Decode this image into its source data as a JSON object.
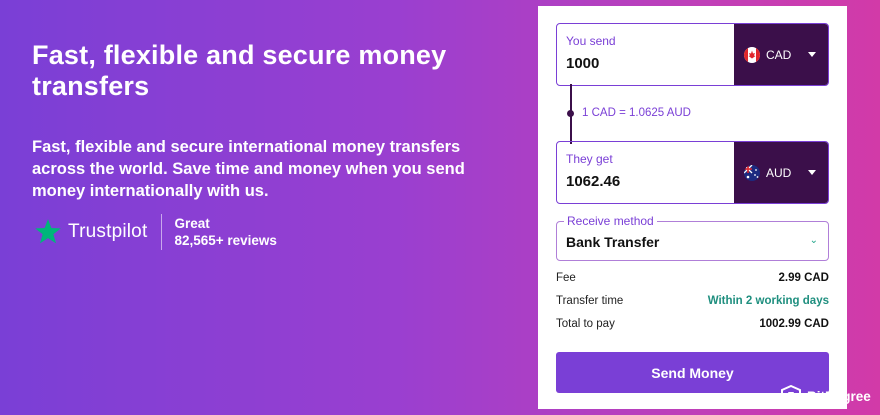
{
  "hero": {
    "title": "Fast, flexible and secure money transfers",
    "description": "Fast, flexible and secure international money transfers across the world. Save time and money when you send money internationally with us."
  },
  "trustpilot": {
    "name": "Trustpilot",
    "rating_word": "Great",
    "reviews": "82,565+ reviews",
    "star_color": "#00b67a",
    "icon": "star-icon"
  },
  "converter": {
    "send": {
      "label": "You send",
      "amount": "1000",
      "currency": "CAD",
      "flag": "canada-flag-icon"
    },
    "rate": "1 CAD = 1.0625 AUD",
    "receive": {
      "label": "They get",
      "amount": "1062.46",
      "currency": "AUD",
      "flag": "australia-flag-icon"
    },
    "method": {
      "label": "Receive method",
      "value": "Bank Transfer"
    },
    "summary": [
      {
        "key": "Fee",
        "value": "2.99 CAD",
        "accent": false
      },
      {
        "key": "Transfer time",
        "value": "Within 2 working days",
        "accent": true
      },
      {
        "key": "Total to pay",
        "value": "1002.99 CAD",
        "accent": false
      }
    ],
    "cta": "Send Money"
  },
  "watermark": {
    "name": "BitDegree"
  },
  "colors": {
    "accent": "#7a3fd6",
    "currency_bg": "#3b0f4a",
    "green": "#1f8f7f"
  }
}
